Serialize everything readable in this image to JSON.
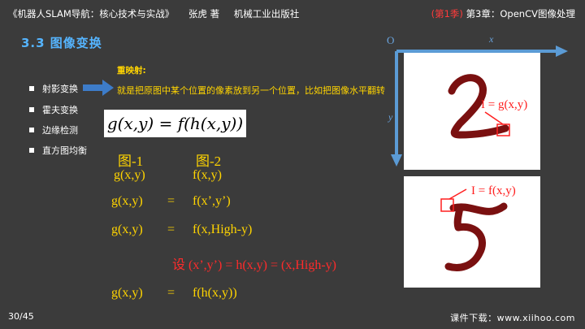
{
  "header": {
    "book": "《机器人SLAM导航：核心技术与实战》",
    "author": "张虎 著",
    "publisher": "机械工业出版社",
    "season": "(第1季)",
    "chapter": "第3章：OpenCV图像处理"
  },
  "title": "3.3 图像变换",
  "remap_label": "重映射:",
  "remap_desc": "就是把原图中某个位置的像素放到另一个位置，比如把图像水平翻转",
  "bullets": [
    "射影变换",
    "霍夫变换",
    "边缘检测",
    "直方图均衡"
  ],
  "formula": "g(x,y) = f(h(x,y))",
  "figures": [
    "图-1",
    "图-2"
  ],
  "rows": [
    {
      "left": "g(x,y)",
      "eq": "",
      "right": "f(x,y)"
    },
    {
      "left": "g(x,y)",
      "eq": "=",
      "right": "f(x’,y’)"
    },
    {
      "left": "g(x,y)",
      "eq": "=",
      "right": "f(x,High-y)"
    },
    {
      "left": "g(x,y)",
      "eq": "=",
      "right": "f(h(x,y))"
    }
  ],
  "assumption": "设 (x’,y’) = h(x,y) = (x,High-y)",
  "axis": {
    "origin": "O",
    "x": "x",
    "y": "y"
  },
  "top_panel_label": "I = g(x,y)",
  "bottom_panel_label": "I = f(x,y)",
  "footer": {
    "page": "30/45",
    "source": "课件下载：www.xiihoo.com"
  },
  "colors": {
    "background": "#3b3b3b",
    "title": "#55b4ff",
    "highlight": "#ffd400",
    "red": "#ff2b2b",
    "axis": "#5b9bd5",
    "stroke": "#7a1010"
  }
}
